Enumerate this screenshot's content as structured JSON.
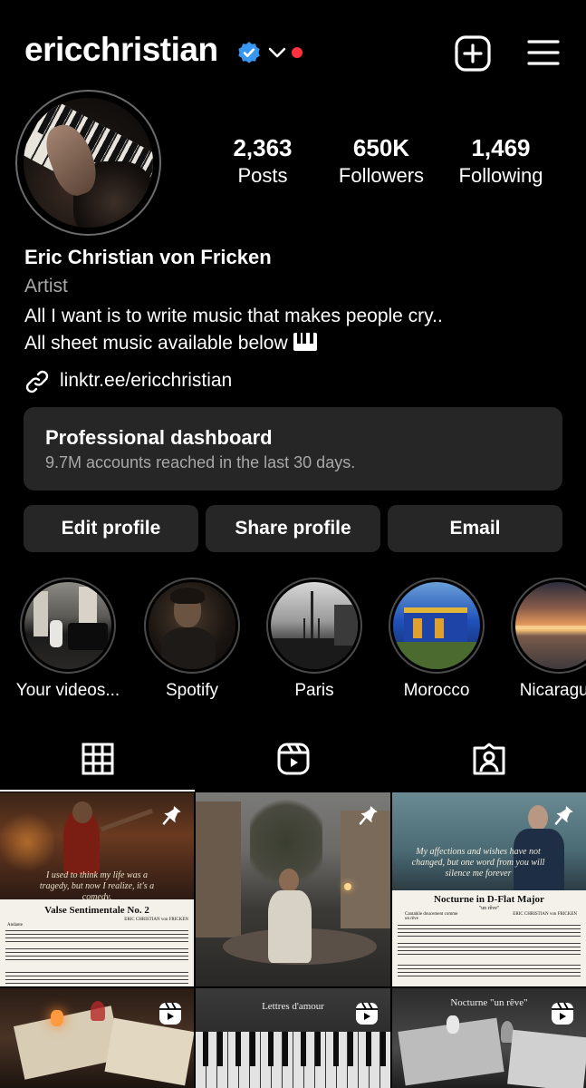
{
  "header": {
    "username": "ericchristian",
    "icons": [
      "verified-badge-icon",
      "chevron-down-icon",
      "notification-dot",
      "new-post-icon",
      "menu-icon"
    ],
    "colors": {
      "verified": "#3897f0",
      "notification_dot": "#ff3040"
    }
  },
  "profile": {
    "stats": [
      {
        "value": "2,363",
        "label": "Posts"
      },
      {
        "value": "650K",
        "label": "Followers"
      },
      {
        "value": "1,469",
        "label": "Following"
      }
    ],
    "full_name": "Eric Christian von Fricken",
    "category": "Artist",
    "bio_line1": "All I want is to write music that makes people cry..",
    "bio_line2": "All sheet music available below",
    "link": "linktr.ee/ericchristian"
  },
  "dashboard": {
    "title": "Professional dashboard",
    "subtitle": "9.7M accounts reached in the last 30 days."
  },
  "actions": {
    "edit": "Edit profile",
    "share": "Share profile",
    "email": "Email"
  },
  "highlights": [
    {
      "label": "Your videos..."
    },
    {
      "label": "Spotify"
    },
    {
      "label": "Paris"
    },
    {
      "label": "Morocco"
    },
    {
      "label": "Nicaragua"
    }
  ],
  "tabs": [
    {
      "icon": "grid-icon",
      "active": true
    },
    {
      "icon": "reels-icon",
      "active": false
    },
    {
      "icon": "tagged-icon",
      "active": false
    }
  ],
  "posts": [
    {
      "overlay": "I used to think my life was a tragedy, but now I realize, it's a comedy.",
      "sheet_title": "Valse Sentimentale No. 2",
      "composer": "ERIC CHRISTIAN von FRICKEN",
      "tempo": "Andante",
      "icon": "pin-icon"
    },
    {
      "icon": "pin-icon"
    },
    {
      "overlay": "My affections and wishes have not changed, but one word from you will silence me forever",
      "sheet_title": "Nocturne in D-Flat Major",
      "sheet_subtitle": "\"un rêve\"",
      "composer": "ERIC CHRISTIAN von FRICKEN",
      "tempo": "Cantabile doucement comme un rêve",
      "icon": "pin-icon"
    },
    {
      "icon": "reels-icon"
    },
    {
      "caption": "Lettres d'amour",
      "icon": "reels-icon"
    },
    {
      "caption": "Nocturne \"un rêve\"",
      "icon": "reels-icon"
    }
  ]
}
